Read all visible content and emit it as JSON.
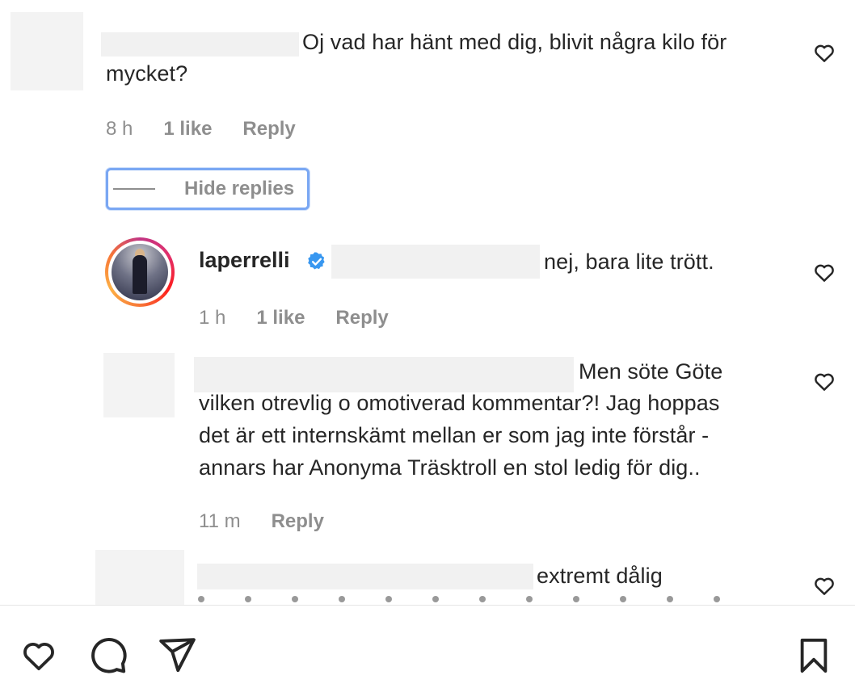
{
  "comments": [
    {
      "text": "Oj vad har hänt med dig, blivit några kilo för mycket?",
      "text_line1": "Oj vad har hänt med dig, blivit några kilo för",
      "text_line2": "mycket?",
      "time": "8 h",
      "likes": "1 like",
      "reply": "Reply"
    }
  ],
  "thread": {
    "hide_replies_label": "Hide replies"
  },
  "replies": [
    {
      "username": "laperrelli",
      "verified": true,
      "text": "nej, bara lite trött.",
      "time": "1 h",
      "likes": "1 like",
      "reply": "Reply"
    },
    {
      "text_line1": "Men söte Göte",
      "text_line2": "vilken otrevlig o omotiverad kommentar?! Jag hoppas",
      "text_line3": "det är ett internskämt mellan er som jag inte förstår -",
      "text_line4": "annars har Anonyma Träsktroll en stol ledig för dig..",
      "time": "11 m",
      "reply": "Reply"
    },
    {
      "text_line1": "extremt dålig"
    }
  ],
  "icons": {
    "like": "heart-icon",
    "comment": "comment-bubble-icon",
    "share": "paper-plane-icon",
    "save": "bookmark-icon",
    "verified": "verified-badge-icon"
  },
  "colors": {
    "text": "#262626",
    "muted": "#8e8e8e",
    "verified": "#3897f0",
    "focus_ring": "#7aa7f3"
  }
}
